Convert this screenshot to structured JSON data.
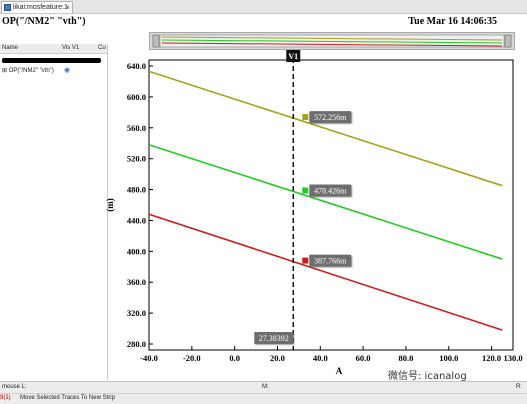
{
  "tab": {
    "label": "likai:mosfeature:1",
    "close": "×"
  },
  "title": "OP(\"/NM2\" \"vth\")",
  "datetime": "Tue Mar 16 14:06:35",
  "left_panel": {
    "col_name": "Name",
    "col_vis": "Vis V1",
    "col_c": "Cu",
    "row": {
      "name": "⊞ OP(\"/NM2\" \"vth\")",
      "eye": "◉"
    }
  },
  "status": {
    "left1": "mouse L:",
    "mid1": "M:",
    "right1": "R:",
    "num": "9(1)",
    "msg": "Move Selected Traces To New Strip"
  },
  "watermark": "微信号: icanalog",
  "chart_data": {
    "type": "line",
    "title": "OP(\"/NM2\" \"vth\")",
    "xlabel": "A",
    "ylabel": "(m)",
    "xlim": [
      -40,
      130
    ],
    "ylim": [
      280,
      640
    ],
    "xticks": [
      -40,
      -20,
      0,
      20,
      40,
      60,
      80,
      100,
      120,
      130
    ],
    "xtick_labels": [
      "-40.0",
      "-20.0",
      "0.0",
      "20.0",
      "40.0",
      "60.0",
      "80.0",
      "100.0",
      "120.0",
      "130.0"
    ],
    "yticks": [
      280,
      320,
      360,
      400,
      440,
      480,
      520,
      560,
      600,
      640
    ],
    "ytick_labels": [
      "280.0",
      "320.0",
      "360.0",
      "400.0",
      "440.0",
      "480.0",
      "520.0",
      "560.0",
      "600.0",
      "640.0"
    ],
    "grid": false,
    "marker": {
      "name": "V1",
      "x": 27.38392,
      "label": "27.38392"
    },
    "series": [
      {
        "color": "#a6a21c",
        "x": [
          -40,
          125
        ],
        "y": [
          633,
          485
        ],
        "marker_label": "572.256m",
        "marker_value": 572.256
      },
      {
        "color": "#22cc22",
        "x": [
          -40,
          125
        ],
        "y": [
          538,
          390
        ],
        "marker_label": "478.426m",
        "marker_value": 478.426
      },
      {
        "color": "#d01c1c",
        "x": [
          -40,
          125
        ],
        "y": [
          448,
          298
        ],
        "marker_label": "387.766m",
        "marker_value": 387.766
      }
    ]
  }
}
